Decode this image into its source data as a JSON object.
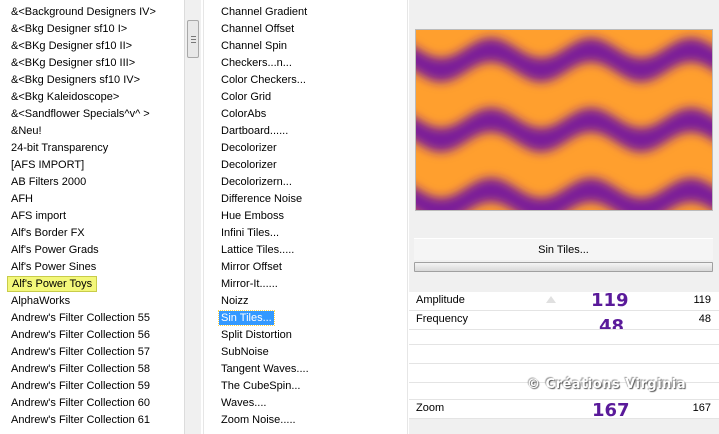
{
  "categories": {
    "items": [
      "&<Background Designers IV>",
      "&<Bkg Designer sf10 I>",
      "&<BKg Designer sf10 II>",
      "&<BKg Designer sf10 III>",
      "&<Bkg Designers sf10 IV>",
      "&<Bkg Kaleidoscope>",
      "&<Sandflower Specials^v^ >",
      "&Neu!",
      "24-bit Transparency",
      "[AFS IMPORT]",
      "AB Filters 2000",
      "AFH",
      "AFS import",
      "Alf's Border FX",
      "Alf's Power Grads",
      "Alf's Power Sines",
      "Alf's Power Toys",
      "AlphaWorks",
      "Andrew's Filter Collection 55",
      "Andrew's Filter Collection 56",
      "Andrew's Filter Collection 57",
      "Andrew's Filter Collection 58",
      "Andrew's Filter Collection 59",
      "Andrew's Filter Collection 60",
      "Andrew's Filter Collection 61"
    ],
    "selected_index": 16
  },
  "filters": {
    "items": [
      "Channel Gradient",
      "Channel Offset",
      "Channel Spin",
      "Checkers...n...",
      "Color Checkers...",
      "Color Grid",
      "ColorAbs",
      "Dartboard......",
      "Decolorizer",
      "Decolorizer",
      "Decolorizern...",
      "Difference Noise",
      "Hue Emboss",
      "Infini Tiles...",
      "Lattice Tiles.....",
      "Mirror Offset",
      "Mirror-It......",
      "Noizz",
      "Sin Tiles...",
      "Split Distortion",
      "SubNoise",
      "Tangent Waves....",
      "The CubeSpin...",
      "Waves....",
      "Zoom Noise....."
    ],
    "selected_index": 18
  },
  "settings": {
    "filter_name": "Sin Tiles...",
    "watermark": "© Créations Virginia",
    "params": [
      {
        "label": "Amplitude",
        "big_value": "119",
        "value": "119"
      },
      {
        "label": "Frequency",
        "big_value": "48",
        "value": "48"
      },
      {
        "label": "Zoom",
        "big_value": "167",
        "value": "167"
      }
    ]
  },
  "colors": {
    "wave_orange": "#ff9f2e",
    "wave_purple": "#7a1f9a",
    "selection_blue": "#3399ff",
    "highlight_yellow": "#f3f77a",
    "value_purple": "#5a1a9a"
  }
}
